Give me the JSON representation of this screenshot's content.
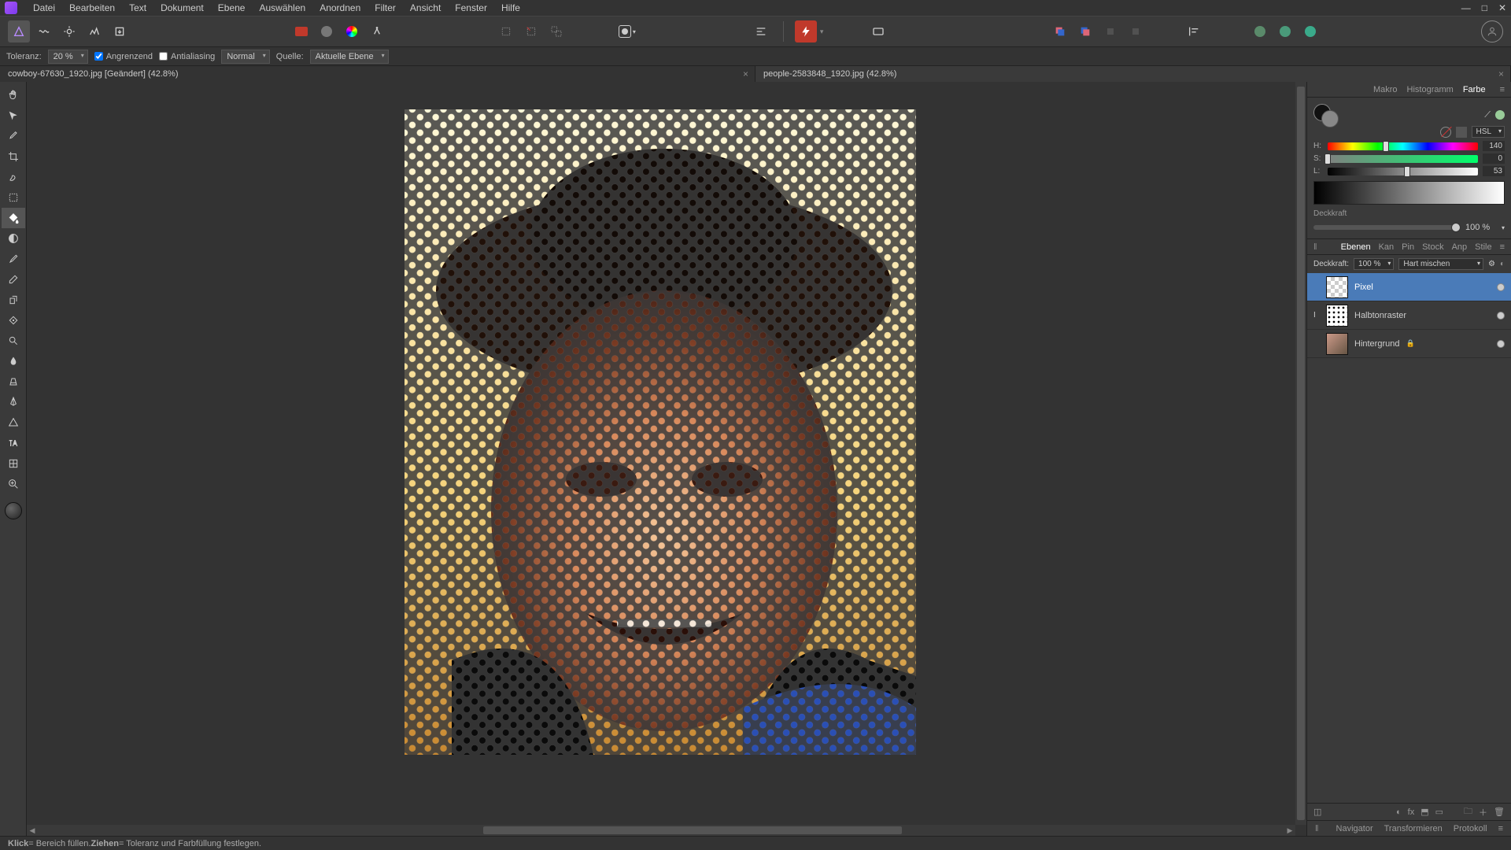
{
  "menu": {
    "items": [
      "Datei",
      "Bearbeiten",
      "Text",
      "Dokument",
      "Ebene",
      "Auswählen",
      "Anordnen",
      "Filter",
      "Ansicht",
      "Fenster",
      "Hilfe"
    ]
  },
  "context": {
    "tolerance_label": "Toleranz:",
    "tolerance_value": "20 %",
    "contiguous": "Angrenzend",
    "antialias": "Antialiasing",
    "blend": "Normal",
    "source_label": "Quelle:",
    "source_value": "Aktuelle Ebene"
  },
  "tabs": [
    {
      "title": "cowboy-67630_1920.jpg [Geändert] (42.8%)",
      "active": true
    },
    {
      "title": "people-2583848_1920.jpg (42.8%)",
      "active": false
    }
  ],
  "color": {
    "panel_tabs": [
      "Makro",
      "Histogramm",
      "Farbe"
    ],
    "mode": "HSL",
    "h": 140,
    "s": 0,
    "l": 53,
    "opacity_label": "Deckkraft",
    "opacity_value": "100 %"
  },
  "layers": {
    "panel_tabs": [
      "Ebenen",
      "Kan",
      "Pin",
      "Stock",
      "Anp",
      "Stile"
    ],
    "opacity_label": "Deckkraft:",
    "opacity_value": "100 %",
    "blend_mode": "Hart mischen",
    "items": [
      {
        "name": "Pixel",
        "selected": true,
        "thumb": "checker",
        "visible": true
      },
      {
        "name": "Halbtonraster",
        "selected": false,
        "thumb": "halftone",
        "visible": true,
        "editable": true
      },
      {
        "name": "Hintergrund",
        "selected": false,
        "thumb": "photo",
        "visible": true,
        "locked": true
      }
    ]
  },
  "bottom_tabs": [
    "Navigator",
    "Transformieren",
    "Protokoll"
  ],
  "status": {
    "klick_b": "Klick",
    "klick": " = Bereich füllen. ",
    "ziehen_b": "Ziehen",
    "ziehen": " = Toleranz und Farbfüllung festlegen."
  }
}
